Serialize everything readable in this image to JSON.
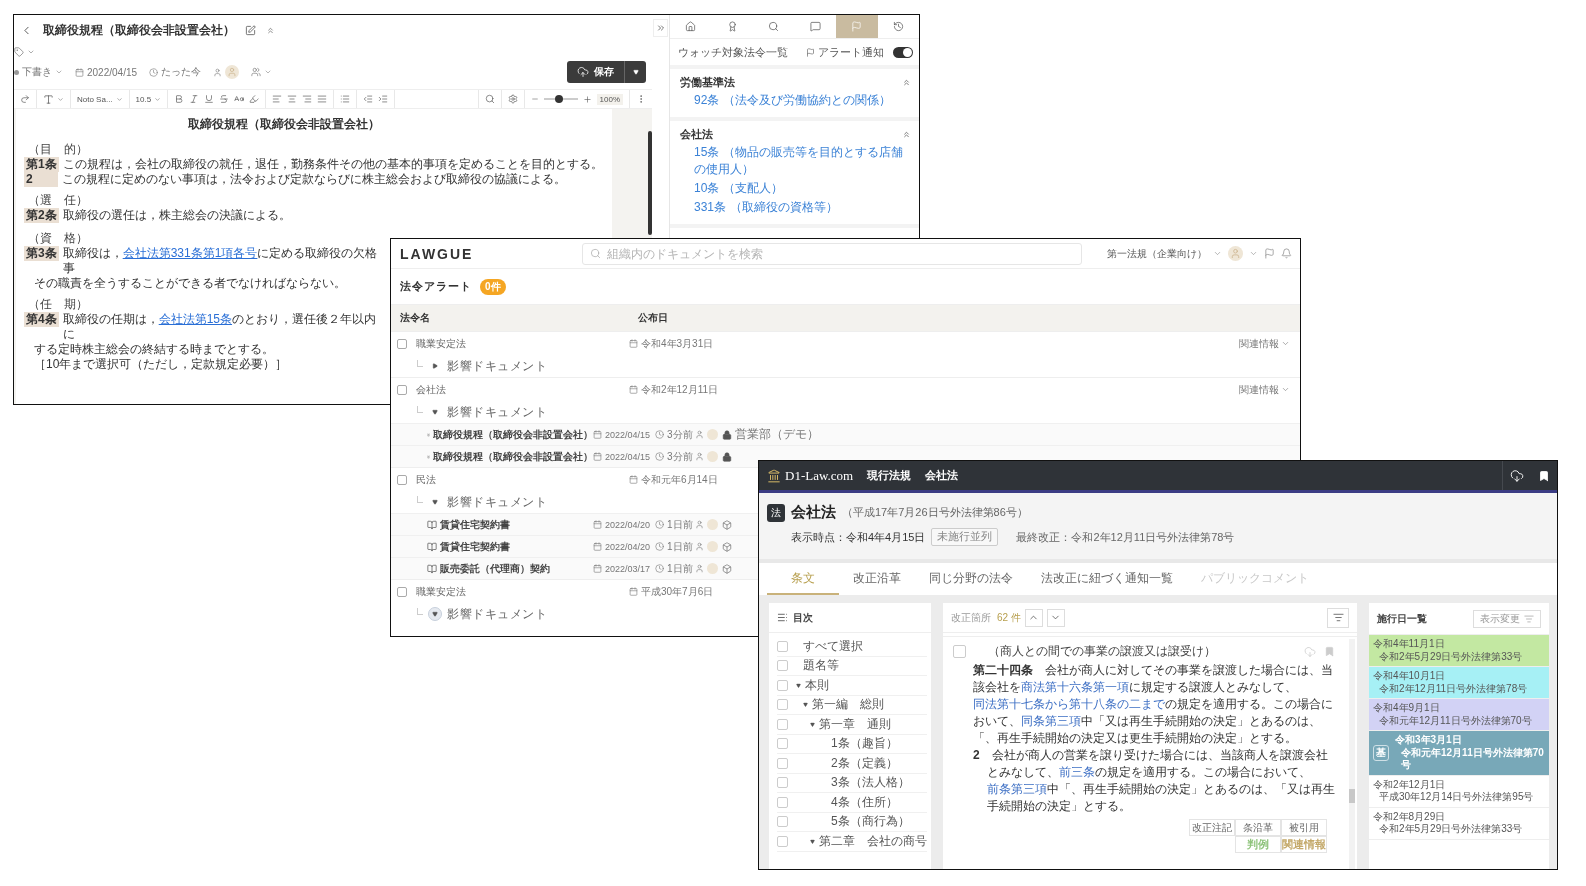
{
  "editor_window": {
    "title": "取締役規程（取締役会非設置会社）",
    "status": "下書き",
    "date": "2022/04/15",
    "updated": "たった今",
    "save_button": "保存",
    "toolbar": {
      "font": "Noto Sa...",
      "font_size": "10.5",
      "level": 0.45,
      "zoom": "100%"
    },
    "document": {
      "title": "取締役規程（取締役会非設置会社）",
      "sections": [
        {
          "heading": "（目　的）",
          "lines": [
            {
              "number": "第1条",
              "parts": [
                {
                  "text": "この規程は，会社の取締役の就任，退任，勤務条件その他の基本的事項を定めることを目的とする。"
                }
              ]
            },
            {
              "number": "2",
              "parts": [
                {
                  "text": "この規程に定めのない事項は，法令および定款ならびに株主総会および取締役の協議による。"
                }
              ]
            }
          ]
        },
        {
          "heading": "（選　任）",
          "lines": [
            {
              "number": "第2条",
              "parts": [
                {
                  "text": "取締役の選任は，株主総会の決議による。"
                }
              ]
            }
          ]
        },
        {
          "heading": "（資　格）",
          "lines": [
            {
              "number": "第3条",
              "parts": [
                {
                  "text": "取締役は，"
                },
                {
                  "text": "会社法第331条第1項各号",
                  "link": true
                },
                {
                  "text": "に定める取締役の欠格事"
                }
              ]
            },
            {
              "parts": [
                {
                  "text": "その職責を全うすることができる者でなければならない。"
                }
              ]
            }
          ]
        },
        {
          "heading": "（任　期）",
          "lines": [
            {
              "number": "第4条",
              "parts": [
                {
                  "text": "取締役の任期は，"
                },
                {
                  "text": "会社法第15条",
                  "link": true
                },
                {
                  "text": "のとおり，選任後２年以内に"
                }
              ]
            },
            {
              "parts": [
                {
                  "text": "する定時株主総会の終結する時までとする。"
                }
              ]
            },
            {
              "parts": [
                {
                  "text": "［10年まで選択可（ただし，定款規定必要）］"
                }
              ]
            }
          ]
        }
      ]
    },
    "watch_panel": {
      "tabs": [
        {
          "kind": "home",
          "selected": false
        },
        {
          "kind": "award",
          "selected": false
        },
        {
          "kind": "search",
          "selected": false
        },
        {
          "kind": "chat",
          "selected": false
        },
        {
          "kind": "flag",
          "selected": true
        },
        {
          "kind": "history",
          "selected": false
        }
      ],
      "title": "ウォッチ対象法令一覧",
      "alert_label": "アラート通知",
      "alert_on": true,
      "groups": [
        {
          "name": "労働基準法",
          "expanded": true,
          "items": [
            {
              "article": "92条",
              "caption": "（法令及び労働協約との関係）"
            }
          ]
        },
        {
          "name": "会社法",
          "expanded": true,
          "items": [
            {
              "article": "15条",
              "caption": "（物品の販売等を目的とする店舗の使用人）"
            },
            {
              "article": "10条",
              "caption": "（支配人）"
            },
            {
              "article": "331条",
              "caption": "（取締役の資格等）"
            }
          ]
        }
      ]
    }
  },
  "lawgue_window": {
    "logo": "LAWGUE",
    "search_placeholder": "組織内のドキュメントを検索",
    "organization": "第一法規（企業向け）",
    "alert_title": "法令アラート",
    "alert_count": "0件",
    "columns": [
      "法令名",
      "公布日"
    ],
    "laws": [
      {
        "name": "職業安定法",
        "date": "令和4年3月31日",
        "checked": false,
        "related": "関連情報",
        "impact": {
          "label": "影響ドキュメント",
          "expanded": false,
          "hovered": false
        }
      },
      {
        "name": "会社法",
        "date": "令和2年12月11日",
        "checked": false,
        "related": "関連情報",
        "impact": {
          "label": "影響ドキュメント",
          "expanded": true,
          "hovered": false,
          "documents": [
            {
              "title": "取締役規程（取締役会非設置会社）",
              "date": "2022/04/15",
              "age": "3分前",
              "kind": "lock",
              "department": "営業部（デモ）"
            },
            {
              "title": "取締役規程（取締役会非設置会社）",
              "date": "2022/04/15",
              "age": "3分前",
              "kind": "lock"
            }
          ]
        }
      },
      {
        "name": "民法",
        "date": "令和元年6月14日",
        "checked": false,
        "impact": {
          "label": "影響ドキュメント",
          "expanded": true,
          "hovered": false,
          "documents": [
            {
              "title": "賃貸住宅契約書",
              "date": "2022/04/20",
              "age": "1日前",
              "kind": "shared"
            },
            {
              "title": "賃貸住宅契約書",
              "date": "2022/04/20",
              "age": "1日前",
              "kind": "shared"
            },
            {
              "title": "販売委託（代理商）契約",
              "date": "2022/03/17",
              "age": "1日前",
              "kind": "shared"
            }
          ]
        }
      },
      {
        "name": "職業安定法",
        "date": "平成30年7月6日",
        "checked": false,
        "impact": {
          "label": "影響ドキュメント",
          "expanded": true,
          "hovered": true
        }
      }
    ]
  },
  "d1_window": {
    "logo": "D1-Law.com",
    "nav": [
      "現行法規",
      "会社法"
    ],
    "law_badge": "法",
    "law_title": "会社法",
    "law_number": "（平成17年7月26日号外法律第86号）",
    "as_of": "表示時点：令和4年4月15日",
    "tag": "未施行並列",
    "last_amended": "最終改正：令和2年12月11日号外法律第78号",
    "tabs": [
      {
        "label": "条文",
        "selected": true,
        "disabled": false
      },
      {
        "label": "改正沿革",
        "selected": false,
        "disabled": false
      },
      {
        "label": "同じ分野の法令",
        "selected": false,
        "disabled": false
      },
      {
        "label": "法改正に紐づく通知一覧",
        "selected": false,
        "disabled": false
      },
      {
        "label": "パブリックコメント",
        "selected": false,
        "disabled": true
      }
    ],
    "toc": {
      "title": "目次",
      "items": [
        {
          "label": "すべて選択",
          "checked": false
        },
        {
          "label": "題名等",
          "checked": false
        },
        {
          "label": "本則",
          "checked": false,
          "expanded": true,
          "children": [
            {
              "label": "第一編　総則",
              "checked": false,
              "expanded": true,
              "children": [
                {
                  "label": "第一章　通則",
                  "checked": false,
                  "expanded": true,
                  "children": [
                    {
                      "label": "1条（趣旨）",
                      "checked": false
                    },
                    {
                      "label": "2条（定義）",
                      "checked": false
                    },
                    {
                      "label": "3条（法人格）",
                      "checked": false
                    },
                    {
                      "label": "4条（住所）",
                      "checked": false
                    },
                    {
                      "label": "5条（商行為）",
                      "checked": false
                    }
                  ]
                },
                {
                  "label": "第二章　会社の商号",
                  "checked": false,
                  "expanded": true
                }
              ]
            }
          ]
        }
      ]
    },
    "amendments": {
      "label": "改正箇所",
      "count": "62 件"
    },
    "article": {
      "caption": "（商人との間での事業の譲渡又は譲受け）",
      "checked": false,
      "paragraphs": [
        {
          "number": "第二十四条",
          "parts": [
            {
              "text": "会社が商人に対してその事業を譲渡した場合には、当該会社を"
            },
            {
              "text": "商法第十六条第一項",
              "link": true
            },
            {
              "text": "に規定する譲渡人とみなして、"
            },
            {
              "text": "同法第十七条から第十八条の二まで",
              "link": true
            },
            {
              "text": "の規定を適用する。この場合において、"
            },
            {
              "text": "同条第三項",
              "link": true
            },
            {
              "text": "中「又は再生手続開始の決定」とあるのは、「、再生手続開始の決定又は更生手続開始の決定」とする。"
            }
          ]
        },
        {
          "number": "2",
          "parts": [
            {
              "text": "会社が商人の営業を譲り受けた場合には、当該商人を譲渡会社とみなして、"
            },
            {
              "text": "前三条",
              "link": true
            },
            {
              "text": "の規定を適用する。この場合において、"
            },
            {
              "text": "前条第三項",
              "link": true
            },
            {
              "text": "中「、再生手続開始の決定」とあるのは、「又は再生手続開始の決定」とする。"
            }
          ]
        }
      ]
    },
    "article_buttons": [
      "改正注記",
      "条沿革",
      "被引用"
    ],
    "article_links": [
      {
        "label": "判例",
        "color": "#8fc47c"
      },
      {
        "label": "関連情報",
        "color": "#c4a96a"
      }
    ],
    "schedule": {
      "title": "施行日一覧",
      "view_button": "表示変更",
      "entries": [
        {
          "date": "令和4年11月1日",
          "law": "令和2年5月29日号外法律第33号",
          "color": "#c3e8a2",
          "selected": false
        },
        {
          "date": "令和4年10月1日",
          "law": "令和2年12月11日号外法律第78号",
          "color": "#a6f0f5",
          "selected": false
        },
        {
          "date": "令和4年9月1日",
          "law": "令和元年12月11日号外法律第70号",
          "color": "#d2d2f5",
          "selected": false
        },
        {
          "date": "令和3年3月1日",
          "law": "令和元年12月11日号外法律第70号",
          "color": "#78a8b8",
          "selected": true,
          "badge": "基"
        },
        {
          "date": "令和2年12月1日",
          "law": "平成30年12月14日号外法律第95号",
          "color": "#ffffff",
          "selected": false
        },
        {
          "date": "令和2年8月29日",
          "law": "令和2年5月29日号外法律第33号",
          "color": "#ffffff",
          "selected": false
        }
      ]
    }
  }
}
